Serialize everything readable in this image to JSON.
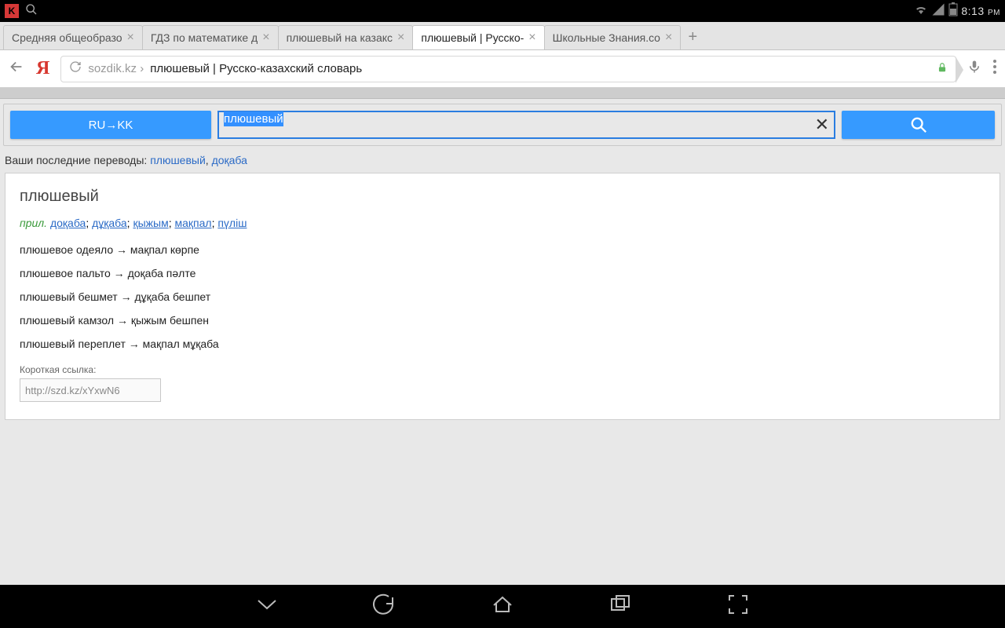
{
  "status": {
    "kaspersky_glyph": "K",
    "time": "8:13",
    "time_suffix": "PM"
  },
  "tabs": [
    {
      "label": "Средняя общеобразо",
      "active": false
    },
    {
      "label": "ГДЗ по математике д",
      "active": false
    },
    {
      "label": "плюшевый на казакс",
      "active": false
    },
    {
      "label": "плюшевый | Русско-",
      "active": true
    },
    {
      "label": "Школьные Знания.co",
      "active": false
    }
  ],
  "url": {
    "host": "sozdik.kz ›",
    "title": "плюшевый | Русско-казахский словарь"
  },
  "searchbar": {
    "lang_label": "RU→KK",
    "term_value": "плюшевый"
  },
  "recent": {
    "prefix": "Ваши последние переводы: ",
    "links": [
      "плюшевый",
      "доқаба"
    ]
  },
  "entry": {
    "headword": "плюшевый",
    "pos": "прил.",
    "translations": [
      "доқаба",
      "дұқаба",
      "қыжым",
      "мақпал",
      "пүліш"
    ],
    "examples": [
      "плюшевое одеяло → мақпал көрпе",
      "плюшевое пальто → доқаба пәлте",
      "плюшевый бешмет → дұқаба бешпет",
      "плюшевый камзол → қыжым бешпен",
      "плюшевый переплет → мақпал мұқаба"
    ],
    "shortlink_label": "Короткая ссылка:",
    "shortlink_value": "http://szd.kz/xYxwN6"
  }
}
